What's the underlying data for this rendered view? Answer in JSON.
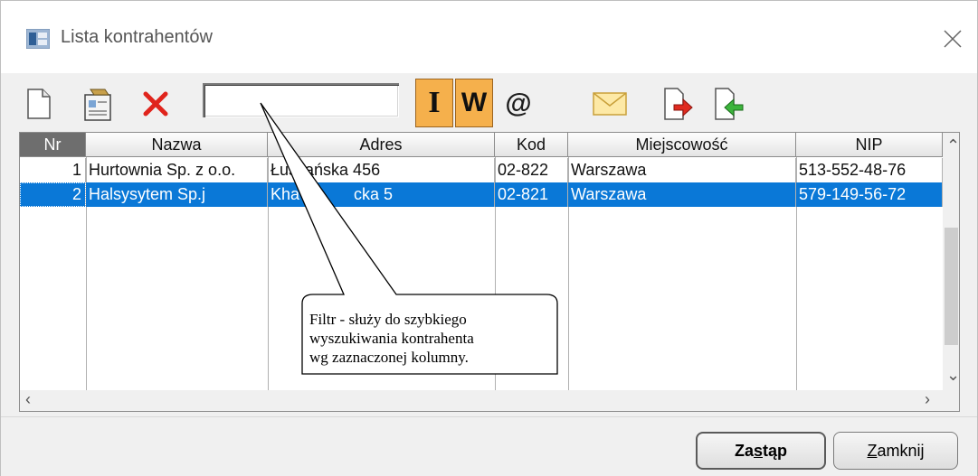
{
  "window": {
    "title": "Lista kontrahentów"
  },
  "toolbar": {
    "new_icon": "new-document-icon",
    "edit_icon": "edit-card-icon",
    "delete_icon": "delete-x-icon",
    "filter": {
      "value": "",
      "placeholder": ""
    },
    "toggle_i_label": "I",
    "toggle_w_label": "W",
    "at_label": "@",
    "mail_icon": "envelope-icon",
    "export_icon": "export-document-icon",
    "import_icon": "import-document-icon"
  },
  "grid": {
    "columns": [
      "Nr",
      "Nazwa",
      "Adres",
      "Kod",
      "Miejscowość",
      "NIP"
    ],
    "rows": [
      {
        "nr": "1",
        "nazwa": "Hurtownia Sp. z o.o.",
        "adres": "Łuszańska 456",
        "kod": "02-822",
        "miejscowosc": "Warszawa",
        "nip": "513-552-48-76",
        "selected": false
      },
      {
        "nr": "2",
        "nazwa": "Halsysytem Sp.j",
        "adres": "Kha",
        "adres_tail": "cka 5",
        "kod": "02-821",
        "miejscowosc": "Warszawa",
        "nip": "579-149-56-72",
        "selected": true
      }
    ]
  },
  "callout": {
    "line1": "Filtr  - służy do szybkiego",
    "line2": "wyszukiwania kontrahenta",
    "line3": "wg zaznaczonej kolumny."
  },
  "buttons": {
    "replace_label_pre": "Za",
    "replace_label_u": "s",
    "replace_label_post": "tąp",
    "close_label_u": "Z",
    "close_label_post": "amknij"
  },
  "colors": {
    "selection": "#0a78d7",
    "toggle": "#f5b04c"
  }
}
